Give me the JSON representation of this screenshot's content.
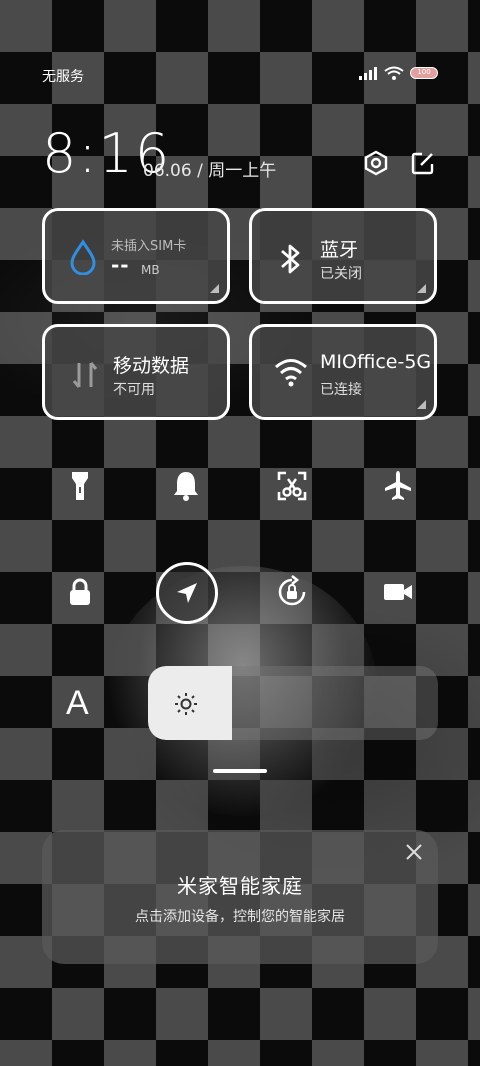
{
  "status": {
    "carrier": "无服务",
    "battery": "100"
  },
  "header": {
    "time": "8:16",
    "date": "06.06 / 周一上午"
  },
  "tiles": {
    "data": {
      "label": "未插入SIM卡",
      "value": "--",
      "unit": "MB"
    },
    "bluetooth": {
      "title": "蓝牙",
      "status": "已关闭"
    },
    "mobile": {
      "title": "移动数据",
      "status": "不可用"
    },
    "wifi": {
      "title": "MIOffice-5G",
      "status": "已连接"
    }
  },
  "brightness": {
    "level": 0.29
  },
  "font_label": "A",
  "card": {
    "title": "米家智能家庭",
    "subtitle": "点击添加设备，控制您的智能家居"
  },
  "colors": {
    "accent_blue": "#2f8fe0",
    "tile_border": "#ffffff"
  }
}
